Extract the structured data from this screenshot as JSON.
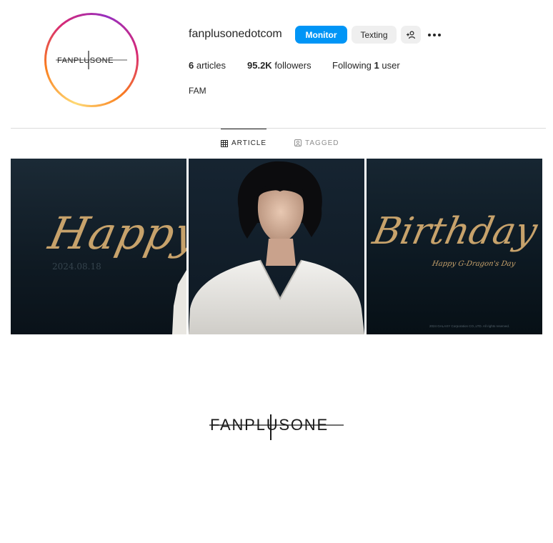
{
  "profile": {
    "avatar_logo_text": "FANPLUSONE",
    "username": "fanplusonedotcom",
    "monitor_label": "Monitor",
    "texting_label": "Texting",
    "add_user_icon": "add-user-icon",
    "more_icon": "more-horizontal-icon",
    "stats": {
      "articles_count": "6",
      "articles_label": " articles",
      "followers_count": "95.2K",
      "followers_label": " followers",
      "following_prefix": "Following ",
      "following_count": "1",
      "following_suffix": " user"
    },
    "bio": "FAM"
  },
  "tabs": [
    {
      "label": "ARTICLE",
      "icon": "grid-icon",
      "active": true
    },
    {
      "label": "TAGGED",
      "icon": "tagged-icon",
      "active": false
    }
  ],
  "posts": [
    {
      "script_text": "Happy",
      "date_text": "2024.08.18"
    },
    {
      "description_icon": "portrait-photo"
    },
    {
      "script_text": "Birthday",
      "subline_text": "Happy G-Dragon's Day",
      "copyright_text": "2024 GALAXY Corporation CO.,LTD. All rights reserved."
    }
  ],
  "footer": {
    "logo_text": "FANPLUSONE"
  },
  "colors": {
    "accent_blue": "#0095f6",
    "button_gray": "#efefef",
    "gold_script": "#c7a26b"
  }
}
